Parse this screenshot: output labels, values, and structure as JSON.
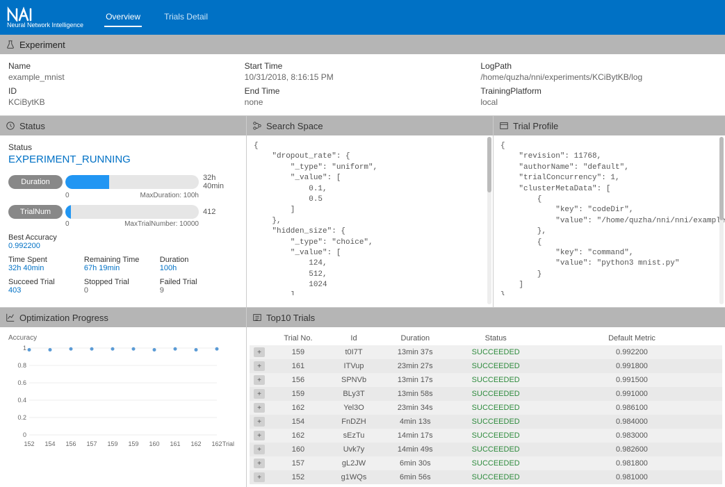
{
  "brand": "Neural Network Intelligence",
  "nav": {
    "overview": "Overview",
    "trials_detail": "Trials Detail"
  },
  "experiment_header": "Experiment",
  "experiment": {
    "name_label": "Name",
    "name": "example_mnist",
    "id_label": "ID",
    "id": "KCiBytKB",
    "start_label": "Start Time",
    "start": "10/31/2018, 8:16:15 PM",
    "end_label": "End Time",
    "end": "none",
    "logpath_label": "LogPath",
    "logpath": "/home/quzha/nni/experiments/KCiBytKB/log",
    "platform_label": "TrainingPlatform",
    "platform": "local"
  },
  "status_header": "Status",
  "status": {
    "status_label": "Status",
    "status": "EXPERIMENT_RUNNING",
    "duration_label": "Duration",
    "duration_text": "32h 40min",
    "max_duration_label": "MaxDuration: 100h",
    "trialnum_label": "TrialNum",
    "trialnum_text": "412",
    "max_trial_label": "MaxTrialNumber: 10000",
    "zero": "0",
    "best_acc_label": "Best Accuracy",
    "best_acc": "0.992200",
    "time_spent_label": "Time Spent",
    "time_spent": "32h 40min",
    "remaining_label": "Remaining Time",
    "remaining": "67h 19min",
    "dur_label": "Duration",
    "dur": "100h",
    "succeed_label": "Succeed Trial",
    "succeed": "403",
    "stopped_label": "Stopped Trial",
    "stopped": "0",
    "failed_label": "Failed Trial",
    "failed": "9"
  },
  "search_space_header": "Search Space",
  "search_space_text": "{\n    \"dropout_rate\": {\n        \"_type\": \"uniform\",\n        \"_value\": [\n            0.1,\n            0.5\n        ]\n    },\n    \"hidden_size\": {\n        \"_type\": \"choice\",\n        \"_value\": [\n            124,\n            512,\n            1024\n        ]\n    },\n    \"learning_rate\": {",
  "trial_profile_header": "Trial Profile",
  "trial_profile_text": "{\n    \"revision\": 11768,\n    \"authorName\": \"default\",\n    \"trialConcurrency\": 1,\n    \"clusterMetaData\": [\n        {\n            \"key\": \"codeDir\",\n            \"value\": \"/home/quzha/nni/nni/examples/trials/mnist-hyperband/.\"\n        },\n        {\n            \"key\": \"command\",\n            \"value\": \"python3 mnist.py\"\n        }\n    ]\n}",
  "opt_header": "Optimization Progress",
  "top10_header": "Top10 Trials",
  "chart_data": {
    "type": "scatter",
    "ylabel": "Accuracy",
    "xlabel": "Trial",
    "x_ticks": [
      "152",
      "154",
      "156",
      "157",
      "159",
      "159",
      "160",
      "161",
      "162",
      "162"
    ],
    "y_ticks": [
      "0",
      "0.2",
      "0.4",
      "0.6",
      "0.8",
      "1"
    ],
    "ylim": [
      0,
      1
    ],
    "series": [
      {
        "name": "Accuracy",
        "values": [
          0.98,
          0.98,
          0.99,
          0.99,
          0.99,
          0.99,
          0.98,
          0.99,
          0.98,
          0.99
        ]
      }
    ]
  },
  "top10": {
    "headers": {
      "trial_no": "Trial No.",
      "id": "Id",
      "duration": "Duration",
      "status": "Status",
      "metric": "Default Metric"
    },
    "rows": [
      {
        "no": "159",
        "id": "t0I7T",
        "dur": "13min 37s",
        "status": "SUCCEEDED",
        "metric": "0.992200"
      },
      {
        "no": "161",
        "id": "ITVup",
        "dur": "23min 27s",
        "status": "SUCCEEDED",
        "metric": "0.991800"
      },
      {
        "no": "156",
        "id": "SPNVb",
        "dur": "13min 17s",
        "status": "SUCCEEDED",
        "metric": "0.991500"
      },
      {
        "no": "159",
        "id": "BLy3T",
        "dur": "13min 58s",
        "status": "SUCCEEDED",
        "metric": "0.991000"
      },
      {
        "no": "162",
        "id": "Yel3O",
        "dur": "23min 34s",
        "status": "SUCCEEDED",
        "metric": "0.986100"
      },
      {
        "no": "154",
        "id": "FnDZH",
        "dur": "4min 13s",
        "status": "SUCCEEDED",
        "metric": "0.984000"
      },
      {
        "no": "162",
        "id": "sEzTu",
        "dur": "14min 17s",
        "status": "SUCCEEDED",
        "metric": "0.983000"
      },
      {
        "no": "160",
        "id": "Uvk7y",
        "dur": "14min 49s",
        "status": "SUCCEEDED",
        "metric": "0.982600"
      },
      {
        "no": "157",
        "id": "gL2JW",
        "dur": "6min 30s",
        "status": "SUCCEEDED",
        "metric": "0.981800"
      },
      {
        "no": "152",
        "id": "g1WQs",
        "dur": "6min 56s",
        "status": "SUCCEEDED",
        "metric": "0.981000"
      }
    ]
  }
}
